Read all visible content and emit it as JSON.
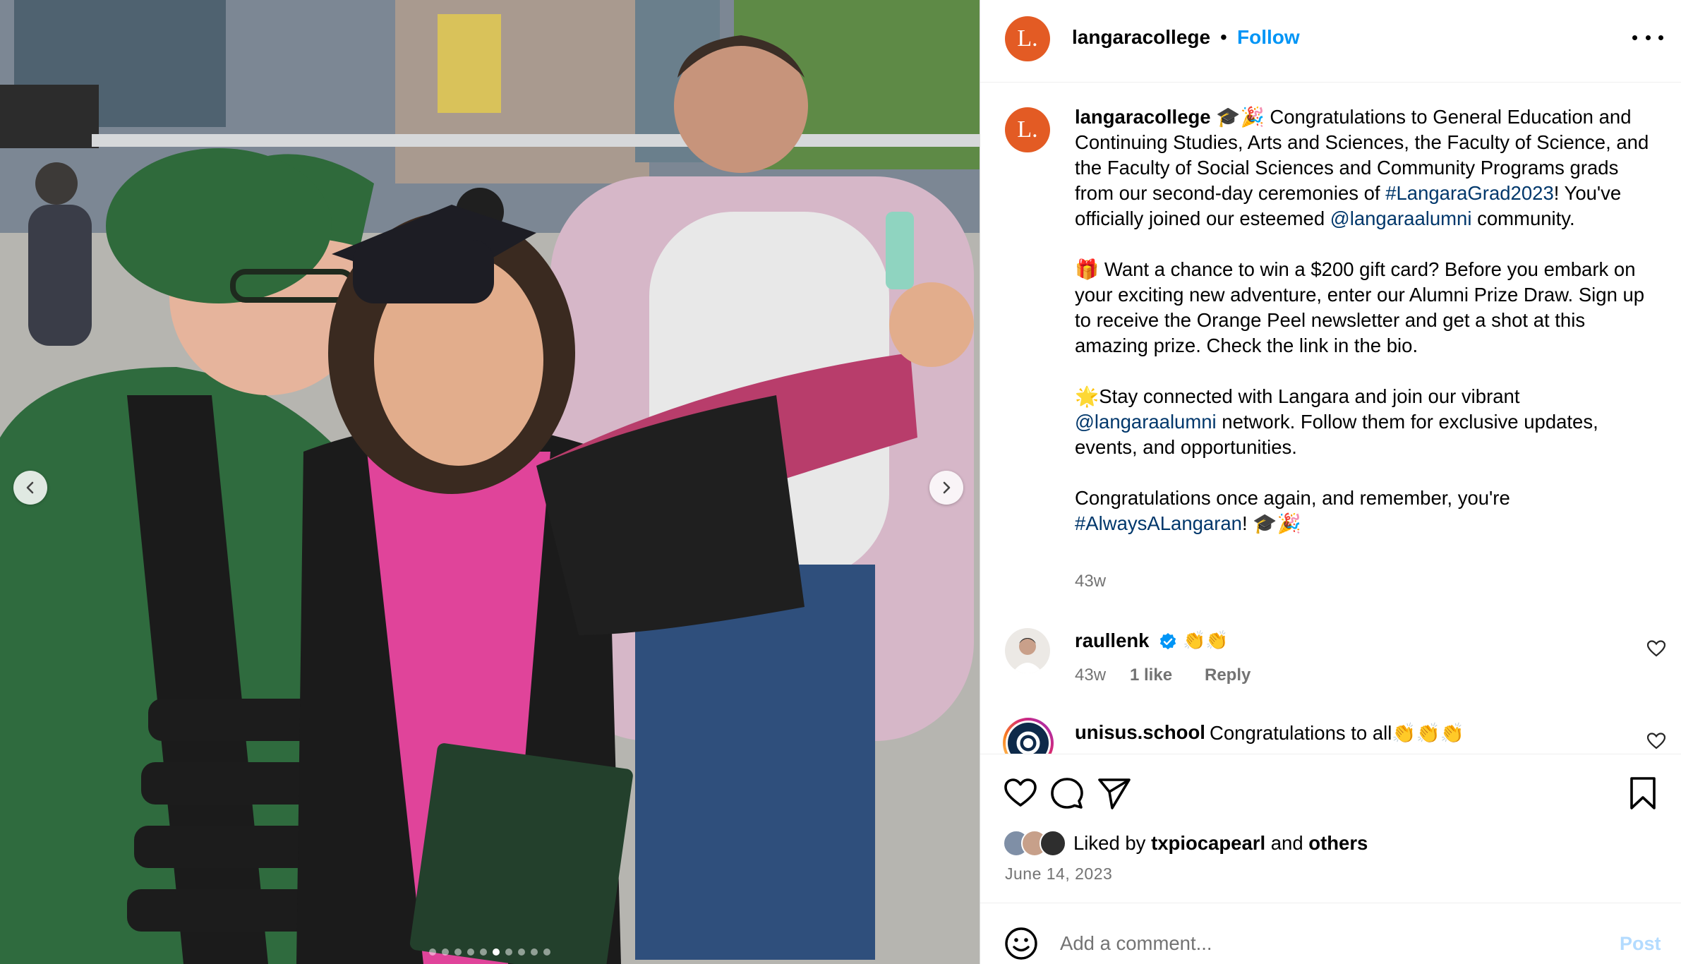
{
  "photo": {
    "alt": "",
    "carousel": {
      "count": 10,
      "active_index": 5
    }
  },
  "header": {
    "avatar_text": "L.",
    "username": "langaracollege",
    "separator": "•",
    "follow_label": "Follow"
  },
  "caption": {
    "avatar_text": "L.",
    "username": "langaracollege",
    "p1_a": " 🎓🎉 Congratulations to General Education and Continuing Studies, Arts and Sciences, the Faculty of Science, and the Faculty of Social Sciences and Community Programs grads from our second-day ceremonies of ",
    "hashtag_1": "#LangaraGrad2023",
    "p1_b": "! You've officially joined our esteemed ",
    "mention_1": "@langaraalumni",
    "p1_c": " community.",
    "p2": "🎁 Want a chance to win a $200 gift card? Before you embark on your exciting new adventure, enter our Alumni Prize Draw. Sign up to receive the Orange Peel newsletter and get a shot at this amazing prize. Check the link in the bio.",
    "p3_a": "🌟Stay connected with Langara and join our vibrant ",
    "mention_2": "@langaraalumni",
    "p3_b": " network. Follow them for exclusive updates, events, and opportunities.",
    "p4_a": "Congratulations once again, and remember, you're ",
    "hashtag_2": "#AlwaysALangaran",
    "p4_b": "! 🎓🎉",
    "time": "43w"
  },
  "comments": [
    {
      "username": "raullenk",
      "verified": true,
      "text": "👏👏",
      "time": "43w",
      "likes": "1 like",
      "reply_label": "Reply"
    },
    {
      "username": "unisus.school",
      "text": "Congratulations to all👏👏👏"
    }
  ],
  "actions": {
    "liked_by_prefix": "Liked by",
    "liked_by_user": "txpiocapearl",
    "liked_by_and": "and",
    "liked_by_others": "others",
    "date": "June 14, 2023"
  },
  "composer": {
    "placeholder": "Add a comment...",
    "post_label": "Post"
  },
  "colors": {
    "brand_orange": "#e35b24",
    "link_blue": "#0095f6",
    "hashtag_blue": "#00376b",
    "muted_gray": "#737373",
    "post_disabled": "#b3dbff"
  },
  "icons": [
    "chevron-left-icon",
    "chevron-right-icon",
    "more-icon",
    "verified-badge-icon",
    "heart-icon",
    "comment-icon",
    "share-icon",
    "bookmark-icon",
    "emoji-icon"
  ]
}
